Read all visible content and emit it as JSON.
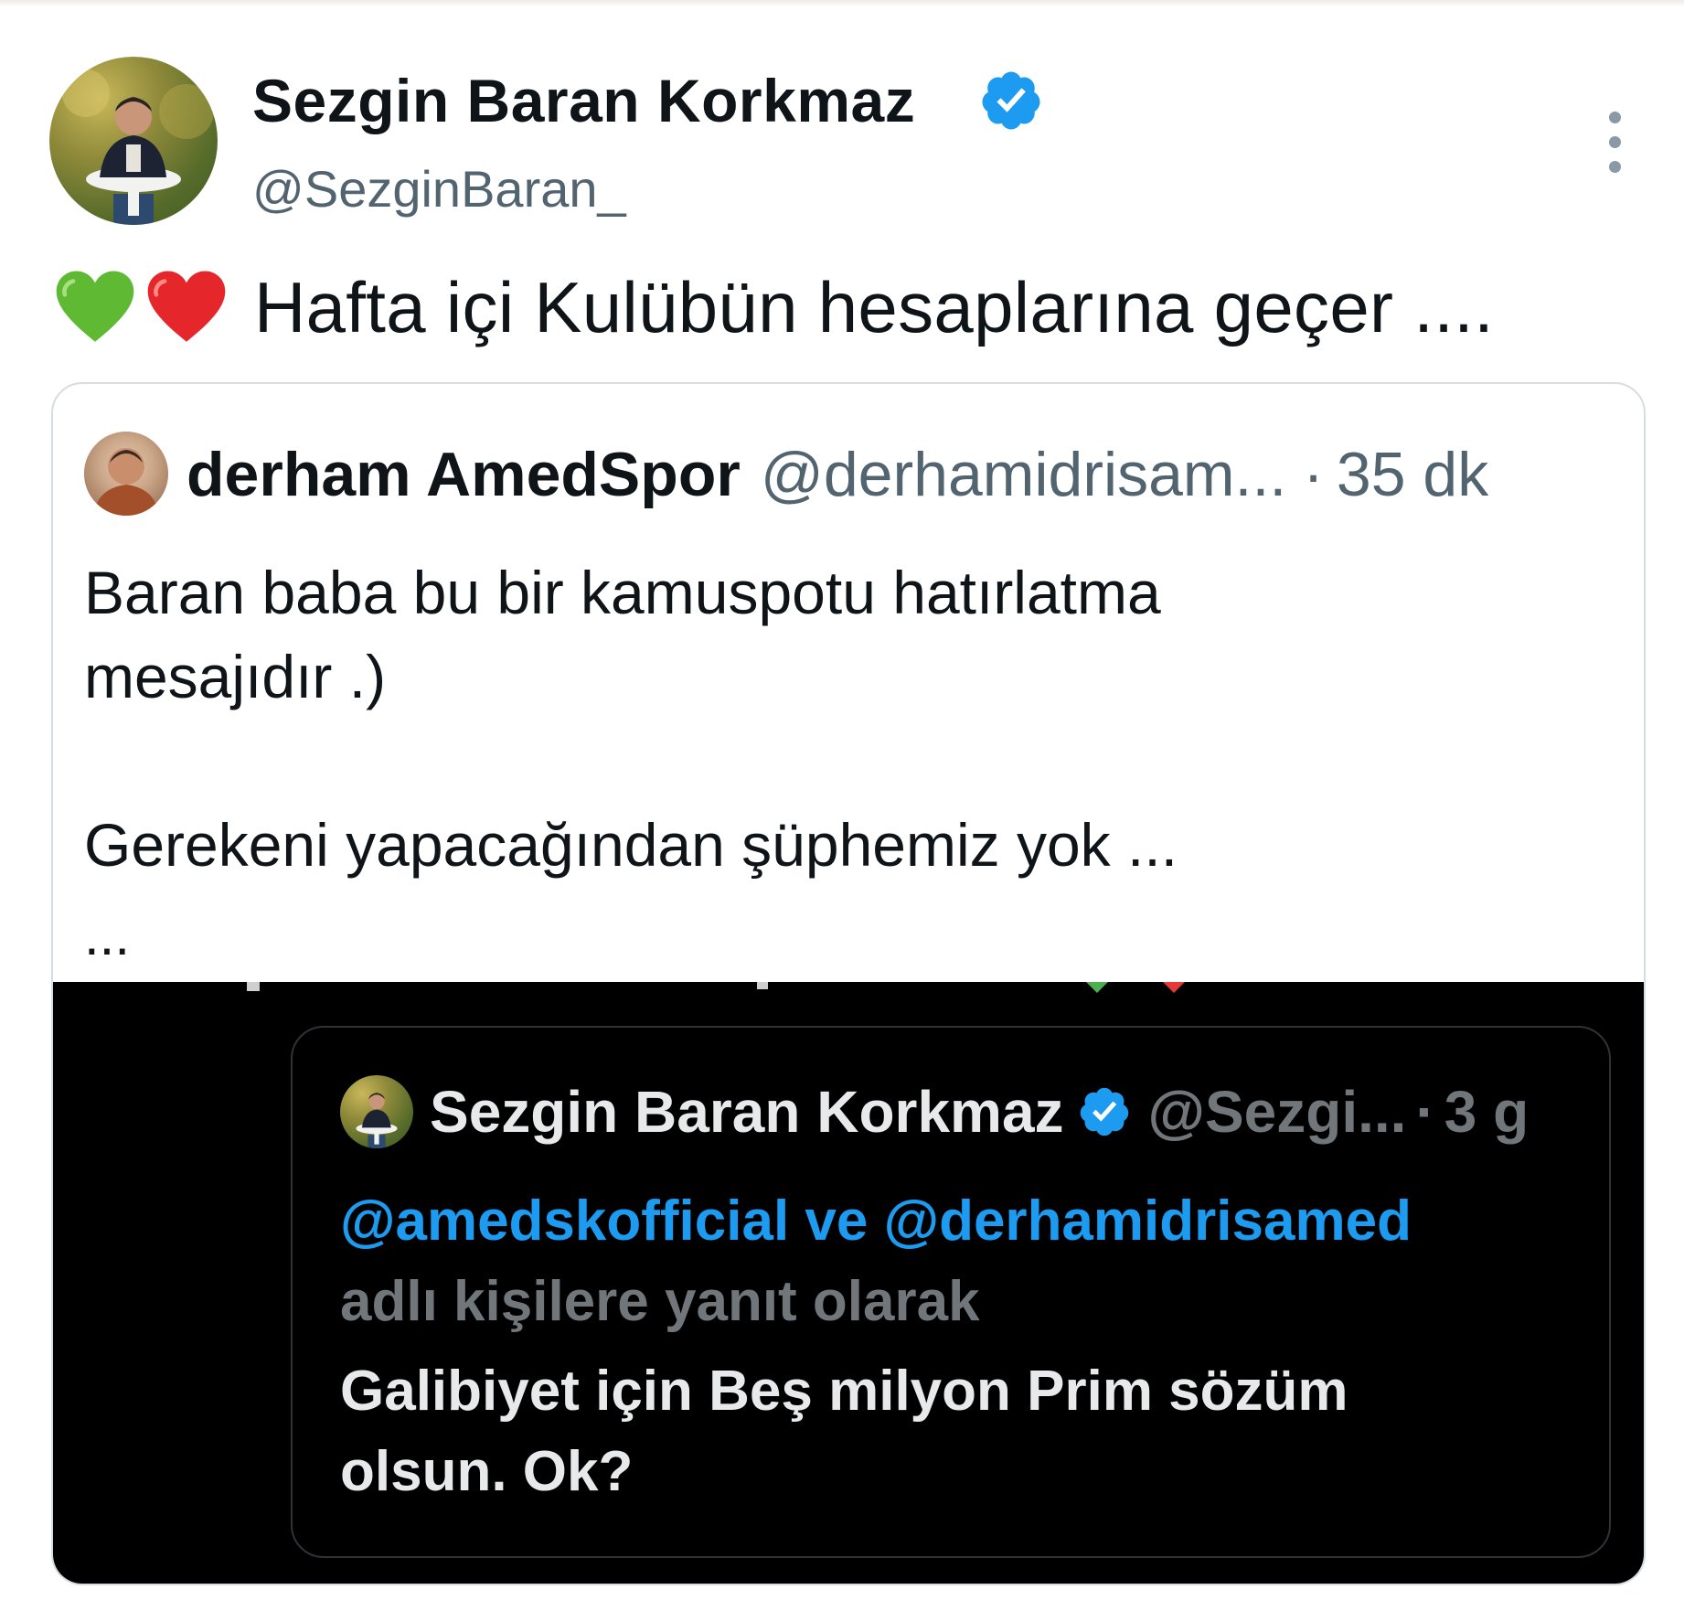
{
  "author": {
    "name": "Sezgin Baran Korkmaz",
    "handle": "@SezginBaran_",
    "verified": true
  },
  "tweet": {
    "emojis": [
      "green-heart",
      "red-heart"
    ],
    "text": "Hafta içi Kulübün hesaplarına geçer ...."
  },
  "quoted_tweet": {
    "name": "derham AmedSpor",
    "handle": "@derhamidrisam...",
    "separator": "·",
    "time": "35 dk",
    "text_lines": [
      "Baran baba bu bir kamuspotu hatırlatma",
      "mesajıdır  .)",
      "",
      "Gerekeni yapacağından şüphemiz yok ..."
    ],
    "ellipsis": "...",
    "embedded_screenshot": {
      "name": "Sezgin Baran Korkmaz",
      "handle": "@Sezgi...",
      "separator": "·",
      "time": "3 g",
      "reply_mention_1": "@amedskofficial",
      "reply_join": "ve",
      "reply_mention_2": "@derhamidrisamed",
      "reply_rest": "adlı kişilere yanıt olarak",
      "body_lines": [
        "Galibiyet için Beş milyon Prim sözüm",
        "olsun. Ok?"
      ]
    }
  },
  "colors": {
    "verified_blue": "#1d9bf0",
    "text_primary": "#0f1419",
    "text_secondary": "#536471",
    "dark_background": "#000000",
    "dark_text": "#e7e9ea",
    "dark_secondary": "#71767b"
  }
}
